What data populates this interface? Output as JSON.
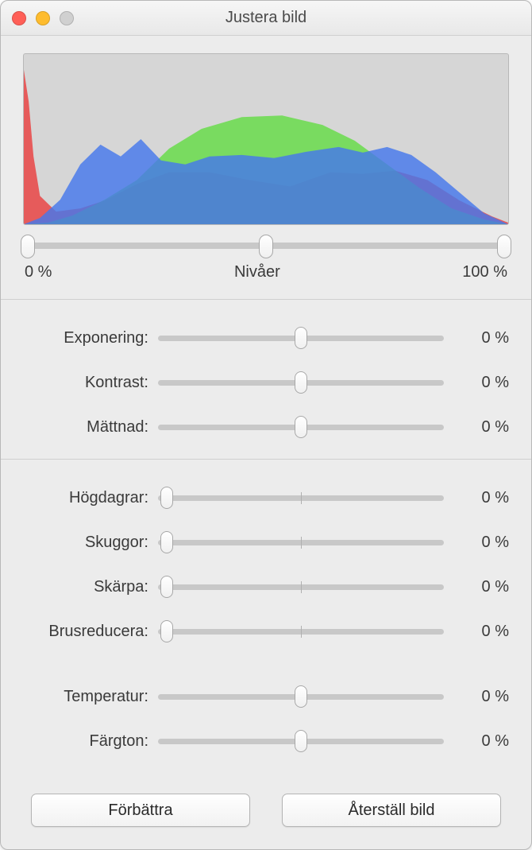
{
  "window": {
    "title": "Justera bild"
  },
  "levels": {
    "left_label": "0 %",
    "center_label": "Nivåer",
    "right_label": "100 %",
    "left_handle_pct": 1,
    "mid_handle_pct": 50,
    "right_handle_pct": 99
  },
  "sliders": {
    "group1": [
      {
        "id": "exposure",
        "label": "Exponering:",
        "value": "0 %",
        "thumb_pct": 50,
        "show_tick": false
      },
      {
        "id": "contrast",
        "label": "Kontrast:",
        "value": "0 %",
        "thumb_pct": 50,
        "show_tick": false
      },
      {
        "id": "saturation",
        "label": "Mättnad:",
        "value": "0 %",
        "thumb_pct": 50,
        "show_tick": false
      }
    ],
    "group2": [
      {
        "id": "highlights",
        "label": "Högdagrar:",
        "value": "0 %",
        "thumb_pct": 3,
        "show_tick": true
      },
      {
        "id": "shadows",
        "label": "Skuggor:",
        "value": "0 %",
        "thumb_pct": 3,
        "show_tick": true
      },
      {
        "id": "sharpness",
        "label": "Skärpa:",
        "value": "0 %",
        "thumb_pct": 3,
        "show_tick": true
      },
      {
        "id": "denoise",
        "label": "Brusreducera:",
        "value": "0 %",
        "thumb_pct": 3,
        "show_tick": true
      }
    ],
    "group3": [
      {
        "id": "temperature",
        "label": "Temperatur:",
        "value": "0 %",
        "thumb_pct": 50,
        "show_tick": false
      },
      {
        "id": "tint",
        "label": "Färgton:",
        "value": "0 %",
        "thumb_pct": 50,
        "show_tick": false
      }
    ]
  },
  "buttons": {
    "enhance": "Förbättra",
    "reset": "Återställ bild"
  }
}
